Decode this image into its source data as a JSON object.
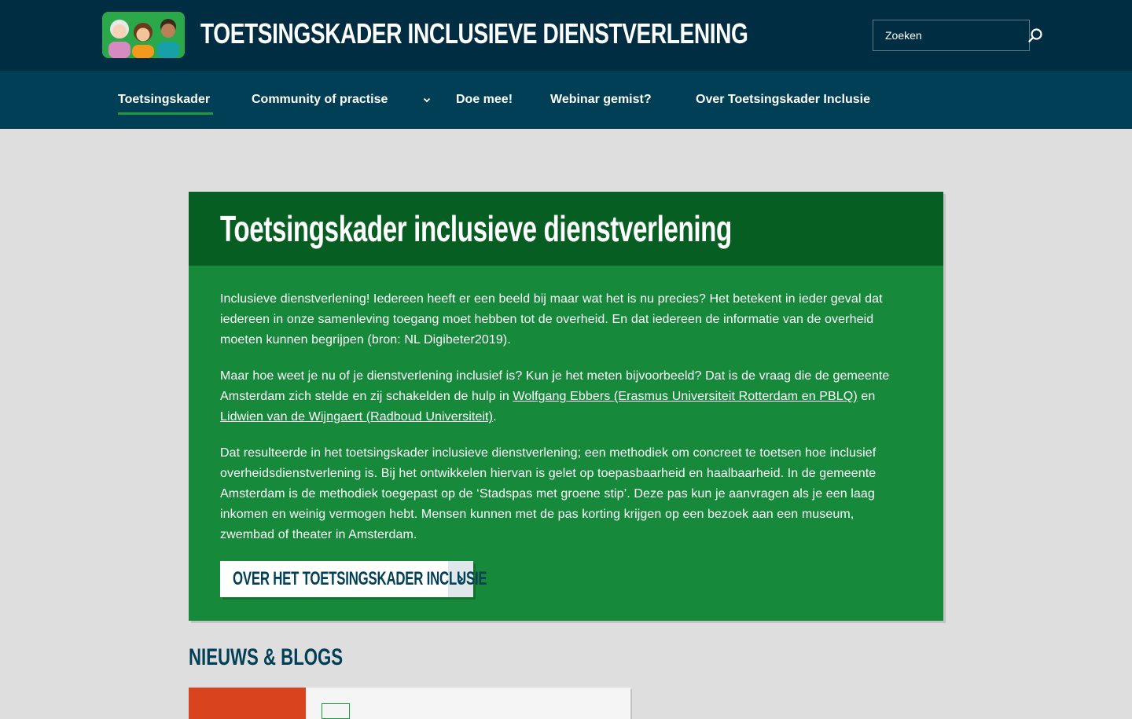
{
  "header": {
    "site_title": "TOETSINGSKADER INCLUSIEVE DIENSTVERLENING",
    "search_placeholder": "Zoeken"
  },
  "nav": {
    "items": [
      {
        "label": "Toetsingskader",
        "active": true
      },
      {
        "label": "Community of practise",
        "has_dropdown": true
      },
      {
        "label": "Doe mee!"
      },
      {
        "label": "Webinar gemist?"
      },
      {
        "label": "Over Toetsingskader Inclusie"
      }
    ]
  },
  "main": {
    "title": "Toetsingskader inclusieve dienstverlening",
    "p1": "Inclusieve dienstverlening! Iedereen heeft er een beeld bij maar wat het is nu precies? Het betekent in ieder geval dat iedereen in onze samenleving toegang moet hebben tot de overheid. En dat iedereen de informatie van de overheid moeten kunnen begrijpen (bron: NL Digibeter2019).",
    "p2_before": "Maar hoe weet je nu of je dienstverlening inclusief is? Kun je het meten bijvoorbeeld? Dat is de vraag die de gemeente Amsterdam zich stelde en zij schakelden de hulp in ",
    "p2_link1": "Wolfgang Ebbers (Erasmus Universiteit Rotterdam en PBLQ)",
    "p2_between": " en ",
    "p2_link2": "Lidwien van de Wijngaert (Radboud Universiteit)",
    "p2_after": ".",
    "p3": "Dat resulteerde in het toetsingskader inclusieve dienstverlening; een methodiek om concreet te toetsen hoe inclusief overheidsdienstverlening is. Bij het ontwikkelen hiervan is gelet op toepasbaarheid en haalbaarheid. In de gemeente Amsterdam is de methodiek toegepast op de ‘Stadspas met groene stip’. Deze pas kun je aanvragen als je een laag inkomen en weinig vermogen hebt. Mensen kunnen met de pas korting krijgen op een bezoek aan een museum, zwembad of theater in Amsterdam.",
    "cta_label": "OVER HET TOETSINGSKADER INCLUSIE"
  },
  "news": {
    "section_title": "NIEUWS & BLOGS"
  },
  "colors": {
    "header_bg": "#002d41",
    "nav_bg": "#003f55",
    "card_bg": "#168a3a",
    "card_head_bg": "#075e22",
    "accent_green": "#1e9a3e",
    "news_image": "#d9431d"
  }
}
